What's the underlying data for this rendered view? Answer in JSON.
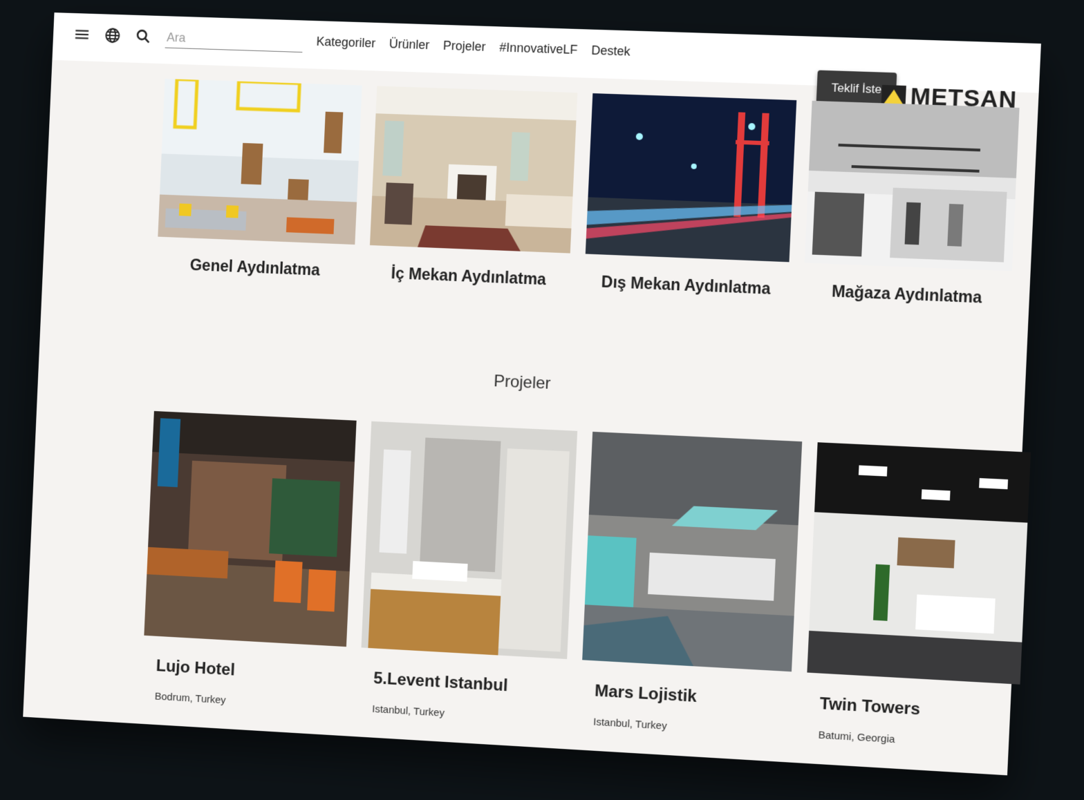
{
  "header": {
    "search_placeholder": "Ara",
    "nav": [
      "Kategoriler",
      "Ürünler",
      "Projeler",
      "#InnovativeLF",
      "Destek"
    ],
    "cta_label": "Teklif İste",
    "brand": "METSAN",
    "icons": [
      "menu-icon",
      "globe-icon",
      "search-icon"
    ]
  },
  "categories": [
    {
      "label": "Genel Aydınlatma"
    },
    {
      "label": "İç Mekan Aydınlatma"
    },
    {
      "label": "Dış Mekan Aydınlatma"
    },
    {
      "label": "Mağaza Aydınlatma"
    }
  ],
  "projects_title": "Projeler",
  "projects": [
    {
      "name": "Lujo Hotel",
      "location": "Bodrum, Turkey"
    },
    {
      "name": "5.Levent Istanbul",
      "location": "Istanbul, Turkey"
    },
    {
      "name": "Mars Lojistik",
      "location": "Istanbul, Turkey"
    },
    {
      "name": "Twin Towers",
      "location": "Batumi, Georgia"
    }
  ],
  "colors": {
    "background": "#0d1317",
    "page": "#f5f3f1",
    "button": "#3a3a3a",
    "brand_yellow": "#f4d23a"
  }
}
